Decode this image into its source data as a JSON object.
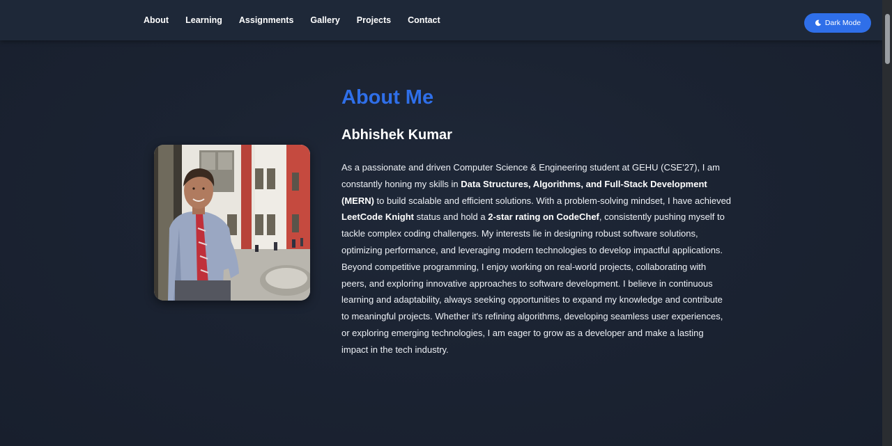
{
  "nav": {
    "links": [
      "About",
      "Learning",
      "Assignments",
      "Gallery",
      "Projects",
      "Contact"
    ],
    "dark_mode_label": "Dark Mode",
    "dark_mode_icon": "moon-icon"
  },
  "about": {
    "title": "About Me",
    "name": "Abhishek Kumar",
    "bio": {
      "p1": "As a passionate and driven Computer Science & Engineering student at GEHU (CSE'27), I am constantly honing my skills in ",
      "b1": "Data Structures, Algorithms, and Full-Stack Development (MERN)",
      "p2": " to build scalable and efficient solutions. With a problem-solving mindset, I have achieved ",
      "b2": "LeetCode Knight",
      "p3": " status and hold a ",
      "b3": "2-star rating on CodeChef",
      "p4": ", consistently pushing myself to tackle complex coding challenges. My interests lie in designing robust software solutions, optimizing performance, and leveraging modern technologies to develop impactful applications. Beyond competitive programming, I enjoy working on real-world projects, collaborating with peers, and exploring innovative approaches to software development. I believe in continuous learning and adaptability, always seeking opportunities to expand my knowledge and contribute to meaningful projects. Whether it's refining algorithms, developing seamless user experiences, or exploring emerging technologies, I am eager to grow as a developer and make a lasting impact in the tech industry."
    }
  },
  "colors": {
    "accent": "#2f6fe9",
    "navbar": "#1e2838",
    "background": "#1b2332"
  }
}
